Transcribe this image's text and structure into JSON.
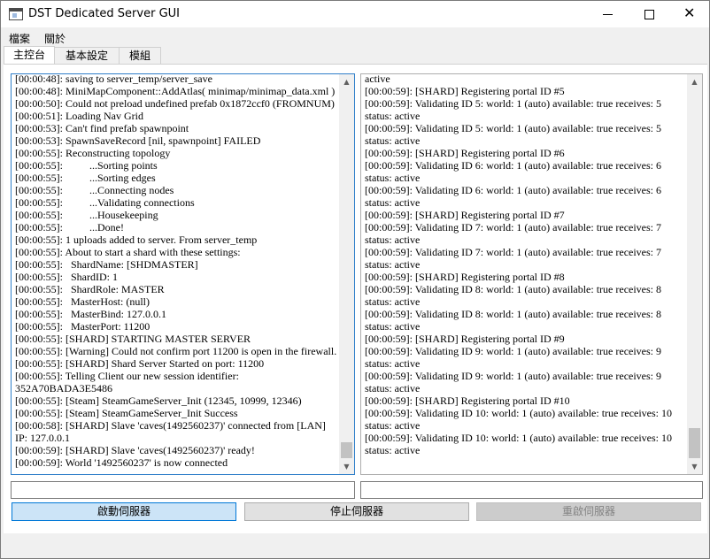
{
  "window": {
    "title": "DST Dedicated Server GUI"
  },
  "menu": {
    "items": [
      "檔案",
      "關於"
    ]
  },
  "tabs": [
    "主控台",
    "基本設定",
    "模組"
  ],
  "console_left": {
    "lines": [
      "[00:00:48]: saving to server_temp/server_save",
      "[00:00:48]: MiniMapComponent::AddAtlas( minimap/minimap_data.xml )",
      "[00:00:50]: Could not preload undefined prefab 0x1872ccf0 (FROMNUM)",
      "[00:00:51]: Loading Nav Grid",
      "[00:00:53]: Can't find prefab spawnpoint",
      "[00:00:53]: SpawnSaveRecord [nil, spawnpoint] FAILED",
      "[00:00:55]: Reconstructing topology",
      "[00:00:55]:          ...Sorting points",
      "[00:00:55]:          ...Sorting edges",
      "[00:00:55]:          ...Connecting nodes",
      "[00:00:55]:          ...Validating connections",
      "[00:00:55]:          ...Housekeeping",
      "[00:00:55]:          ...Done!",
      "[00:00:55]: 1 uploads added to server. From server_temp",
      "[00:00:55]: About to start a shard with these settings:",
      "[00:00:55]:   ShardName: [SHDMASTER]",
      "[00:00:55]:   ShardID: 1",
      "[00:00:55]:   ShardRole: MASTER",
      "[00:00:55]:   MasterHost: (null)",
      "[00:00:55]:   MasterBind: 127.0.0.1",
      "[00:00:55]:   MasterPort: 11200",
      "[00:00:55]: [SHARD] STARTING MASTER SERVER",
      "[00:00:55]: [Warning] Could not confirm port 11200 is open in the firewall.",
      "[00:00:55]: [SHARD] Shard Server Started on port: 11200",
      "[00:00:55]: Telling Client our new session identifier: 352A70BADA3E5486",
      "[00:00:55]: [Steam] SteamGameServer_Init (12345, 10999, 12346)",
      "[00:00:55]: [Steam] SteamGameServer_Init Success",
      "[00:00:58]: [SHARD] Slave 'caves(1492560237)' connected from [LAN] IP: 127.0.0.1",
      "[00:00:59]: [SHARD] Slave 'caves(1492560237)' ready!",
      "[00:00:59]: World '1492560237' is now connected"
    ]
  },
  "console_right": {
    "lines": [
      "active",
      "[00:00:59]: [SHARD] Registering portal ID #5",
      "[00:00:59]: Validating ID 5: world: 1 (auto) available: true receives: 5 status: active",
      "[00:00:59]: Validating ID 5: world: 1 (auto) available: true receives: 5 status: active",
      "[00:00:59]: [SHARD] Registering portal ID #6",
      "[00:00:59]: Validating ID 6: world: 1 (auto) available: true receives: 6 status: active",
      "[00:00:59]: Validating ID 6: world: 1 (auto) available: true receives: 6 status: active",
      "[00:00:59]: [SHARD] Registering portal ID #7",
      "[00:00:59]: Validating ID 7: world: 1 (auto) available: true receives: 7 status: active",
      "[00:00:59]: Validating ID 7: world: 1 (auto) available: true receives: 7 status: active",
      "[00:00:59]: [SHARD] Registering portal ID #8",
      "[00:00:59]: Validating ID 8: world: 1 (auto) available: true receives: 8 status: active",
      "[00:00:59]: Validating ID 8: world: 1 (auto) available: true receives: 8 status: active",
      "[00:00:59]: [SHARD] Registering portal ID #9",
      "[00:00:59]: Validating ID 9: world: 1 (auto) available: true receives: 9 status: active",
      "[00:00:59]: Validating ID 9: world: 1 (auto) available: true receives: 9 status: active",
      "[00:00:59]: [SHARD] Registering portal ID #10",
      "[00:00:59]: Validating ID 10: world: 1 (auto) available: true receives: 10 status: active",
      "[00:00:59]: Validating ID 10: world: 1 (auto) available: true receives: 10 status: active"
    ]
  },
  "inputs": {
    "left_value": "",
    "right_value": ""
  },
  "buttons": {
    "start": "啟動伺服器",
    "stop": "停止伺服器",
    "restart": "重啟伺服器"
  },
  "colors": {
    "start_button_bg": "#cce4f7",
    "focus_border": "#0078d7"
  }
}
